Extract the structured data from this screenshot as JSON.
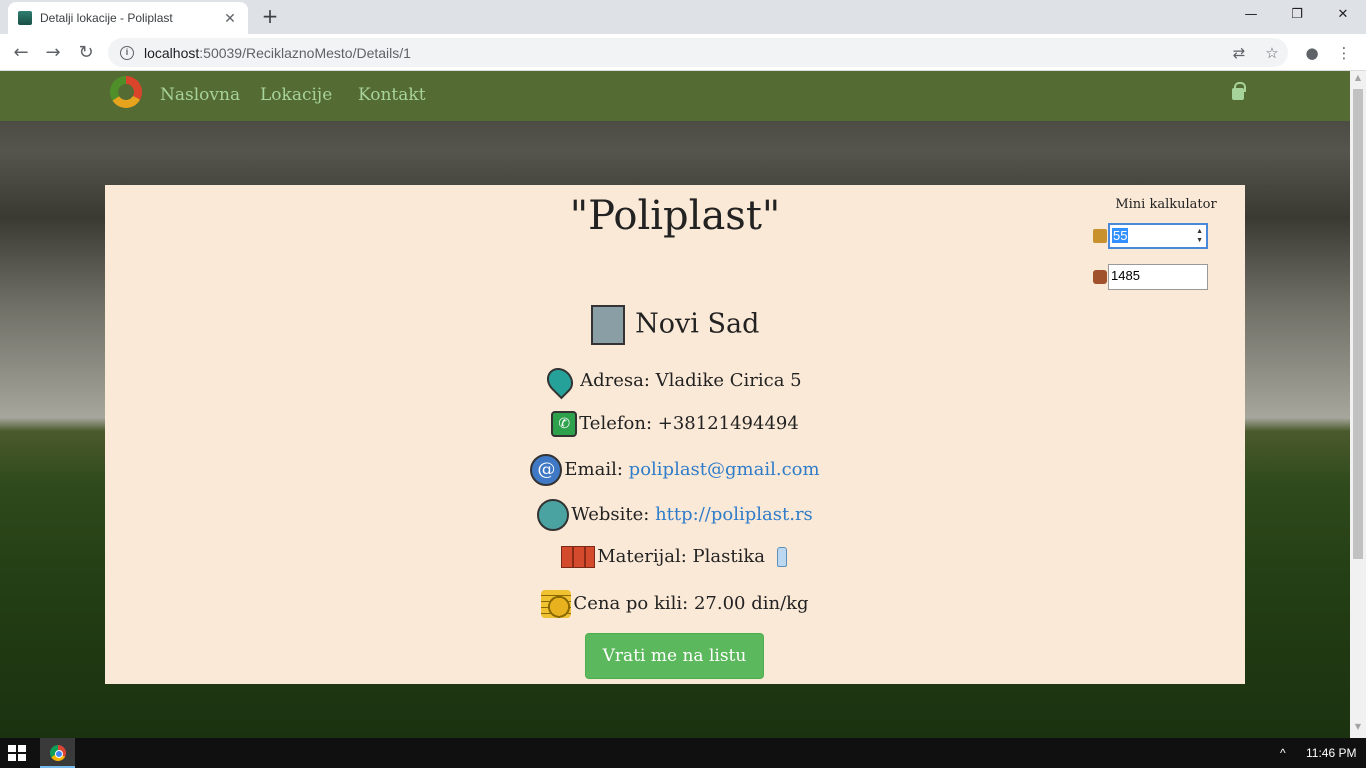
{
  "browser": {
    "tab_title": "Detalji lokacije - Poliplast",
    "tab_close": "✕",
    "new_tab": "+",
    "url_host": "localhost",
    "url_path": ":50039/ReciklaznoMesto/Details/1",
    "win_minimize": "—",
    "win_maximize": "❐",
    "win_close": "✕",
    "back": "←",
    "forward": "→",
    "reload": "↻",
    "translate": "⇄",
    "bookmark": "☆",
    "account": "●",
    "menu": "⋮"
  },
  "site_nav": {
    "links": [
      "Naslovna",
      "Lokacije",
      "Kontakt"
    ]
  },
  "details": {
    "title": "\"Poliplast\"",
    "city": "Novi Sad",
    "address_label": "Adresa:",
    "address": "Vladike Cirica 5",
    "phone_label": "Telefon:",
    "phone": "+38121494494",
    "email_label": "Email:",
    "email": "poliplast@gmail.com",
    "website_label": "Website:",
    "website": "http://poliplast.rs",
    "material_label": "Materijal:",
    "material": "Plastika",
    "price_label": "Cena po kili:",
    "price": "27.00 din/kg",
    "back_button": "Vrati me na listu"
  },
  "calculator": {
    "title": "Mini kalkulator",
    "weight_value": "55",
    "total_value": "1485"
  },
  "taskbar": {
    "time": "11:46 PM",
    "tray_arrow": "^"
  }
}
